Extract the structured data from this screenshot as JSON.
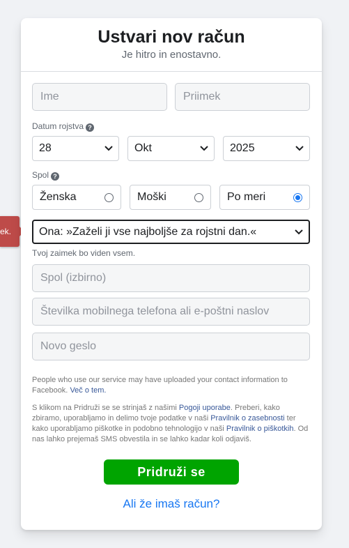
{
  "header": {
    "title": "Ustvari nov račun",
    "subtitle": "Je hitro in enostavno."
  },
  "form": {
    "first_name_placeholder": "Ime",
    "last_name_placeholder": "Priimek",
    "birthday_label": "Datum rojstva",
    "birthday": {
      "day": "28",
      "month": "Okt",
      "year": "2025"
    },
    "gender_label": "Spol",
    "gender_options": [
      {
        "label": "Ženska",
        "selected": false
      },
      {
        "label": "Moški",
        "selected": false
      },
      {
        "label": "Po meri",
        "selected": true
      }
    ],
    "pronoun_value": "Ona: »Zaželi ji vse najboljše za rojstni dan.«",
    "pronoun_hint": "Tvoj zaimek bo viden vsem.",
    "custom_gender_placeholder": "Spol (izbirno)",
    "contact_placeholder": "Številka mobilnega telefona ali e-poštni naslov",
    "password_placeholder": "Novo geslo"
  },
  "notice": {
    "text": "People who use our service may have uploaded your contact information to Facebook.",
    "link": "Več o tem."
  },
  "terms": {
    "part1": "S klikom na Pridruži se se strinjaš z našimi ",
    "link_terms": "Pogoji uporabe",
    "part2": ". Preberi, kako zbiramo, uporabljamo in delimo tvoje podatke v naši ",
    "link_privacy": "Pravilnik o zasebnosti",
    "part3": " ter kako uporabljamo piškotke in podobno tehnologijo v naši ",
    "link_cookies": "Pravilnik o piškotkih",
    "part4": ". Od nas lahko prejemaš SMS obvestila in se lahko kadar koli odjaviš."
  },
  "submit_label": "Pridruži se",
  "login_link": "Ali že imaš račun?",
  "tooltip_text": "ek.",
  "colors": {
    "primary": "#1877f2",
    "submit": "#00a400",
    "error": "#be4b49"
  }
}
